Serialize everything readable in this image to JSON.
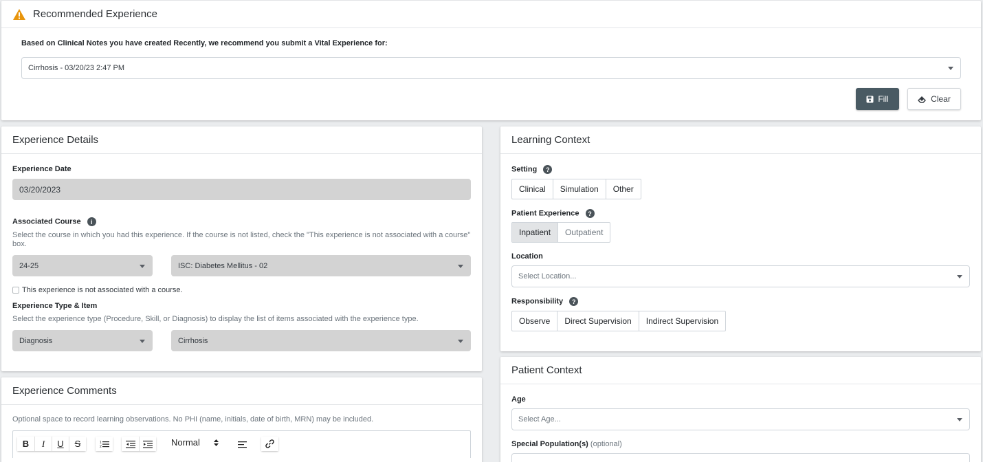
{
  "recommended": {
    "title": "Recommended Experience",
    "prompt": "Based on Clinical Notes you have created Recently, we recommend you submit a Vital Experience for:",
    "selected": "Cirrhosis - 03/20/23 2:47 PM",
    "fill_label": "Fill",
    "clear_label": "Clear"
  },
  "details": {
    "title": "Experience Details",
    "date_label": "Experience Date",
    "date_value": "03/20/2023",
    "course_label": "Associated Course",
    "course_help": "Select the course in which you had this experience. If the course is not listed, check the \"This experience is not associated with a course\" box.",
    "year_value": "24-25",
    "course_value": "ISC: Diabetes Mellitus - 02",
    "no_course_label": "This experience is not associated with a course.",
    "type_label": "Experience Type & Item",
    "type_help": "Select the experience type (Procedure, Skill, or Diagnosis) to display the list of items associated with the experience type.",
    "type_value": "Diagnosis",
    "item_value": "Cirrhosis"
  },
  "comments": {
    "title": "Experience Comments",
    "help": "Optional space to record learning observations. No PHI (name, initials, date of birth, MRN) may be included.",
    "format_value": "Normal"
  },
  "learning": {
    "title": "Learning Context",
    "setting_label": "Setting",
    "setting_options": [
      "Clinical",
      "Simulation",
      "Other"
    ],
    "patient_label": "Patient Experience",
    "patient_options": [
      "Inpatient",
      "Outpatient"
    ],
    "location_label": "Location",
    "location_placeholder": "Select Location...",
    "responsibility_label": "Responsibility",
    "responsibility_options": [
      "Observe",
      "Direct Supervision",
      "Indirect Supervision"
    ]
  },
  "patient_context": {
    "title": "Patient Context",
    "age_label": "Age",
    "age_placeholder": "Select Age...",
    "special_label": "Special Population(s)",
    "special_optional": "(optional)"
  },
  "colors": {
    "warning": "#e8950c",
    "primary_dark": "#495a63"
  }
}
